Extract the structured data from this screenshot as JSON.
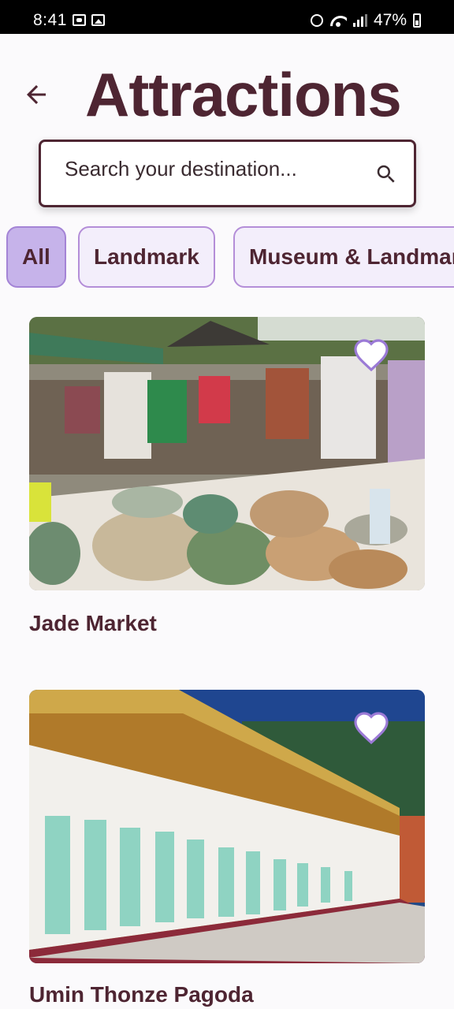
{
  "status": {
    "time": "8:41",
    "battery": "47%"
  },
  "header": {
    "title": "Attractions",
    "back_icon": "arrow-left-icon"
  },
  "search": {
    "placeholder": "Search your destination..."
  },
  "filters": [
    {
      "label": "All",
      "selected": true
    },
    {
      "label": "Landmark",
      "selected": false
    },
    {
      "label": "Museum & Landmark",
      "selected": false
    }
  ],
  "attractions": [
    {
      "name": "Jade Market",
      "favorite_icon": "heart-outline-icon"
    },
    {
      "name": "Umin Thonze Pagoda",
      "favorite_icon": "heart-outline-icon"
    }
  ],
  "colors": {
    "accent": "#4e2532",
    "chip_selected": "#c6b3ea",
    "chip_border": "#b48ed8",
    "heart": "#9b7ad6"
  }
}
